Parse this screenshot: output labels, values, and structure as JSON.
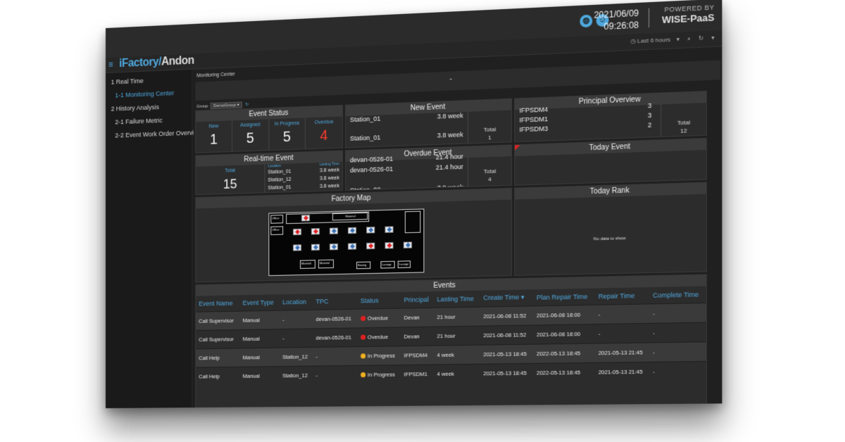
{
  "topbar": {
    "date": "2021/06/09",
    "time": "09:26:08",
    "powered_by": "POWERED BY",
    "brand": "WISE-PaaS",
    "icons": [
      "globe-icon",
      "user-icon"
    ]
  },
  "app": {
    "brand_if": "iFactory/",
    "brand_andon": "Andon",
    "time_range": "Last 6 hours",
    "menu_icon": "menu-icon"
  },
  "sidebar": {
    "items": [
      {
        "label": "1 Real Time"
      },
      {
        "label": "1-1 Monitoring Center"
      },
      {
        "label": "2 History Analysis"
      },
      {
        "label": "2-1 Failure Metric"
      },
      {
        "label": "2-2 Event Work Order Overview"
      }
    ]
  },
  "main": {
    "breadcrumb": "Monitoring Center",
    "banner": "-",
    "group_label": "Group",
    "group_value": "DemoGroup"
  },
  "event_status": {
    "title": "Event Status",
    "cols": [
      {
        "label": "New",
        "value": "1"
      },
      {
        "label": "Assigned",
        "value": "5"
      },
      {
        "label": "In Progress",
        "value": "5"
      },
      {
        "label": "Overdue",
        "value": "4"
      }
    ]
  },
  "new_event": {
    "title": "New Event",
    "rows": [
      {
        "name": "Station_01",
        "time": "3.8 week"
      },
      {
        "name": "Station_01",
        "time": "3.8 week"
      }
    ],
    "total_label": "Total",
    "total": "1"
  },
  "principal_overview": {
    "title": "Principal Overview",
    "rows": [
      {
        "name": "IFPSDM4",
        "count": "3"
      },
      {
        "name": "IFPSDM1",
        "count": "3"
      },
      {
        "name": "IFPSDM3",
        "count": "2"
      }
    ],
    "total_label": "Total",
    "total": "12"
  },
  "realtime_event": {
    "title": "Real-time Event",
    "total_label": "Total",
    "total": "15",
    "location_label": "Location",
    "lasting_label": "Lasting Time",
    "rows": [
      {
        "name": "Station_01",
        "time": "3.8 week"
      },
      {
        "name": "Station_12",
        "time": "3.8 week"
      },
      {
        "name": "Station_01",
        "time": "3.8 week"
      }
    ]
  },
  "overdue_event": {
    "title": "Overdue Event",
    "rows": [
      {
        "name": "devan-0526-01",
        "time": "21.4 hour"
      },
      {
        "name": "devan-0526-01",
        "time": "21.4 hour"
      },
      {
        "name": "Station_02",
        "time": "3.9 week"
      }
    ],
    "total_label": "Total",
    "total": "4"
  },
  "today_event": {
    "title": "Today Event"
  },
  "factory_map": {
    "title": "Factory Map",
    "rooms": [
      "Office",
      "Office",
      "Material",
      "Material",
      "Material",
      "Boxing",
      "Lounge",
      "Lounge"
    ]
  },
  "today_rank": {
    "title": "Today Rank",
    "empty": "No data to show"
  },
  "events": {
    "title": "Events",
    "columns": [
      "Event Name",
      "Event Type",
      "Location",
      "TPC",
      "Status",
      "Principal",
      "Lasting Time",
      "Create Time ▾",
      "Plan Repair Time",
      "Repair Time",
      "Complete Time"
    ],
    "rows": [
      {
        "name": "Call Supervisor",
        "type": "Manual",
        "location": "-",
        "tpc": "devan-0526-01",
        "status": "Overdue",
        "status_color": "#e02020",
        "principal": "Devan",
        "lasting": "21 hour",
        "create": "2021-06-08 11:52",
        "plan": "2021-06-08 18:00",
        "repair": "-",
        "complete": "-"
      },
      {
        "name": "Call Supervisor",
        "type": "Manual",
        "location": "-",
        "tpc": "devan-0526-01",
        "status": "Overdue",
        "status_color": "#e02020",
        "principal": "Devan",
        "lasting": "21 hour",
        "create": "2021-06-08 11:52",
        "plan": "2021-06-08 18:00",
        "repair": "-",
        "complete": "-"
      },
      {
        "name": "Call Help",
        "type": "Manual",
        "location": "Station_12",
        "tpc": "-",
        "status": "In Progress",
        "status_color": "#f0b020",
        "principal": "IFPSDM4",
        "lasting": "4 week",
        "create": "2021-05-13 18:45",
        "plan": "2022-05-13 18:45",
        "repair": "2021-05-13 21:45",
        "complete": "-"
      },
      {
        "name": "Call Help",
        "type": "Manual",
        "location": "Station_12",
        "tpc": "-",
        "status": "In Progress",
        "status_color": "#f0b020",
        "principal": "IFPSDM1",
        "lasting": "4 week",
        "create": "2021-05-13 18:45",
        "plan": "2022-05-13 18:45",
        "repair": "2021-05-13 21:45",
        "complete": "-"
      }
    ]
  }
}
